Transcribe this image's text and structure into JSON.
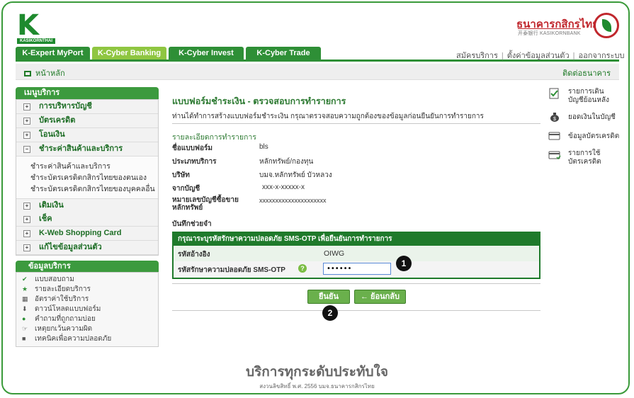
{
  "header": {
    "logo_text": "KASIKORNTHAI",
    "bank_name_th": "ธนาคารกสิกรไทย",
    "bank_name_en": "开泰银行 KASIKORNBANK"
  },
  "tabs": [
    {
      "label": "K-Expert MyPort"
    },
    {
      "label": "K-Cyber Banking"
    },
    {
      "label": "K-Cyber Invest"
    },
    {
      "label": "K-Cyber Trade"
    }
  ],
  "top_links": [
    "สมัครบริการ",
    "ตั้งค่าข้อมูลส่วนตัว",
    "ออกจากระบบ"
  ],
  "subbar": {
    "home": "หน้าหลัก",
    "contact": "ติดต่อธนาคาร"
  },
  "menu": {
    "title": "เมนูบริการ",
    "items": [
      {
        "label": "การบริหารบัญชี",
        "sign": "+"
      },
      {
        "label": "บัตรเครดิต",
        "sign": "+"
      },
      {
        "label": "โอนเงิน",
        "sign": "+"
      },
      {
        "label": "ชำระค่าสินค้าและบริการ",
        "sign": "−"
      },
      {
        "label": "เติมเงิน",
        "sign": "+"
      },
      {
        "label": "เช็ค",
        "sign": "+"
      },
      {
        "label": "K-Web Shopping Card",
        "sign": "+"
      },
      {
        "label": "แก้ไขข้อมูลส่วนตัว",
        "sign": "+"
      }
    ],
    "subitems": [
      "ชำระค่าสินค้าและบริการ",
      "ชำระบัตรเครดิตกสิกรไทยของตนเอง",
      "ชำระบัตรเครดิตกสิกรไทยของบุคคลอื่น"
    ]
  },
  "info": {
    "title": "ข้อมูลบริการ",
    "items": [
      {
        "label": "แบบสอบถาม",
        "icon": "check-icon"
      },
      {
        "label": "รายละเอียดบริการ",
        "icon": "star-icon"
      },
      {
        "label": "อัตราค่าใช้บริการ",
        "icon": "calculator-icon"
      },
      {
        "label": "ดาวน์โหลดแบบฟอร์ม",
        "icon": "download-icon"
      },
      {
        "label": "คำถามที่ถูกถามบ่อย",
        "icon": "question-icon"
      },
      {
        "label": "เหตุยกเว้นความผิด",
        "icon": "hand-icon"
      },
      {
        "label": "เทคนิคเพื่อความปลอดภัย",
        "icon": "lock-icon"
      }
    ]
  },
  "form": {
    "title": "แบบฟอร์มชำระเงิน - ตรวจสอบการทำรายการ",
    "description": "ท่านได้ทำการสร้างแบบฟอร์มชำระเงิน กรุณาตรวจสอบความถูกต้องของข้อมูลก่อนยืนยันการทำรายการ",
    "section_title": "รายละเอียดการทำรายการ",
    "rows": [
      {
        "label": "ชื่อแบบฟอร์ม",
        "value": "bls"
      },
      {
        "label": "ประเภทบริการ",
        "value": "หลักทรัพย์/กองทุน"
      },
      {
        "label": "บริษัท",
        "value": "บมจ.หลักทรัพย์ บัวหลวง"
      },
      {
        "label": "จากบัญชี",
        "value": "xxx-x-xxxxx-x"
      },
      {
        "label": "หมายเลขบัญชีซื้อขาย หลักทรัพย์",
        "value": "xxxxxxxxxxxxxxxxxxxxx"
      }
    ],
    "memo_label": "บันทึกช่วยจำ"
  },
  "otp": {
    "header": "กรุณาระบุรหัสรักษาความปลอดภัย SMS-OTP เพื่อยืนยันการทำรายการ",
    "ref_label": "รหัสอ้างอิง",
    "ref_value": "OIWG",
    "otp_label": "รหัสรักษาความปลอดภัย SMS-OTP",
    "otp_value": "••••••"
  },
  "buttons": {
    "confirm": "ยืนยัน",
    "back": "← ย้อนกลับ"
  },
  "badges": [
    "1",
    "2"
  ],
  "side_links": [
    {
      "label1": "รายการเดิน",
      "label2": "บัญชีย้อนหลัง",
      "icon": "statement-icon"
    },
    {
      "label1": "ยอดเงินในบัญชี",
      "label2": "",
      "icon": "money-bag-icon"
    },
    {
      "label1": "ข้อมูลบัตรเครดิต",
      "label2": "",
      "icon": "credit-card-icon"
    },
    {
      "label1": "รายการใช้",
      "label2": "บัตรเครดิต",
      "icon": "card-list-icon"
    }
  ],
  "footer": {
    "slogan": "บริการทุกระดับประทับใจ",
    "copyright": "สงวนลิขสิทธิ์ พ.ศ. 2556 บมจ.ธนาคารกสิกรไทย"
  },
  "colors": {
    "brand_green": "#2e8f36",
    "active_tab": "#8fc641",
    "bank_red": "#c0272d"
  }
}
